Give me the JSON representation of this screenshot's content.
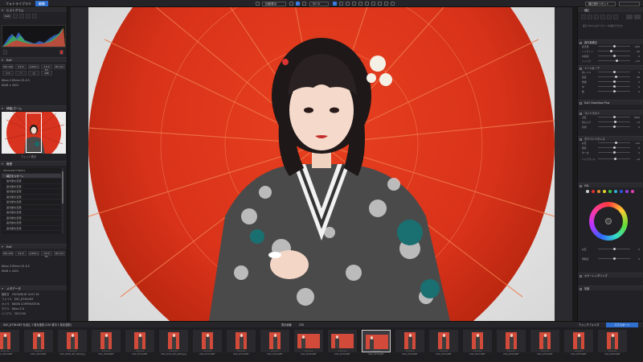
{
  "topbar": {
    "tabs": [
      "フォトライブラリ",
      "編集"
    ],
    "view_label": "比較表示",
    "zoom": "50 %",
    "right_button": "補正値をリセット"
  },
  "left": {
    "histogram_title": "ヒストグラム",
    "exif": {
      "iso": "ISO 100",
      "aperture": "f/1.8",
      "shutter": "1/250 s",
      "ev": "±0.0 EV",
      "focal": "85 mm",
      "lens": "Nikon Z 85mm f/1.8 S",
      "dims": "6048 × 4024"
    },
    "navigator_title": "移動/ズーム",
    "navigator_mode": "フィット表示",
    "history_title": "履歴",
    "history_sub": "Advanced History",
    "history_items": [
      "補正をスタート",
      "露光量を変更",
      "露光量を変更",
      "露光量を変更",
      "露光量を変更",
      "露光量を変更",
      "露光量を変更",
      "露光量を変更",
      "露光量を変更",
      "露光量を変更",
      "露光量を変更",
      "露光量を変更"
    ],
    "meta_title": "メタデータ",
    "meta_rows": [
      [
        "撮影日",
        "2023/06/16 14:07:16"
      ],
      [
        "ファイル",
        "DSC_8736.NEF"
      ],
      [
        "カメラ",
        "NIKON CORPORATION"
      ],
      [
        "モデル",
        "Nikon Z 8"
      ],
      [
        "シリアル",
        "3021740"
      ]
    ]
  },
  "right": {
    "title": "補正",
    "tabs": [
      "ライト",
      "カラー",
      "ディテール"
    ],
    "sections": [
      "露光量補正",
      "トーンカーブ",
      "DxO ClearView Plus",
      "コントラスト",
      "ホワイトバランス",
      "HSL",
      "カラーレンダリング",
      "彩度"
    ],
    "sliders": [
      {
        "label": "露光量",
        "value": "0.00",
        "pos": 0.5
      },
      {
        "label": "ハイライト",
        "value": "-20",
        "pos": 0.4
      },
      {
        "label": "中間調",
        "value": "0",
        "pos": 0.5
      },
      {
        "label": "シャドウ",
        "value": "+15",
        "pos": 0.58
      },
      {
        "label": "黒レベル",
        "value": "0",
        "pos": 0.5
      },
      {
        "label": "強度",
        "value": "50",
        "pos": 0.55
      },
      {
        "label": "微細",
        "value": "0",
        "pos": 0.5
      },
      {
        "label": "中",
        "value": "0",
        "pos": 0.5
      },
      {
        "label": "粗",
        "value": "0",
        "pos": 0.5
      },
      {
        "label": "温度",
        "value": "5250",
        "pos": 0.52
      },
      {
        "label": "色かぶり",
        "value": "+3",
        "pos": 0.53
      },
      {
        "label": "色相",
        "value": "0",
        "pos": 0.5
      },
      {
        "label": "彩度",
        "value": "+10",
        "pos": 0.56
      },
      {
        "label": "輝度",
        "value": "0",
        "pos": 0.5
      },
      {
        "label": "均一性",
        "value": "0",
        "pos": 0.5
      },
      {
        "label": "バイブランス",
        "value": "+8",
        "pos": 0.54
      },
      {
        "label": "彩度",
        "value": "0",
        "pos": 0.5
      },
      {
        "label": "明瞭度",
        "value": "0",
        "pos": 0.5
      }
    ],
    "swatch_colors": [
      "#cccccc",
      "#e03030",
      "#e08a30",
      "#e0d030",
      "#40c040",
      "#30b0d0",
      "#3050e0",
      "#9040e0",
      "#e040b0"
    ]
  },
  "filmstrip": {
    "status": "DSC_8736.NEF を含む 1 枚を選択 (230 枚中 1 枚を選択)",
    "count_label": "表示画像",
    "count": "230",
    "mode_label": "ウォッチフォルダ",
    "btn": "エクスポート",
    "thumbs": [
      "DSC_8702.NEF",
      "DSC_8705.NEF",
      "DSC_8706_DE_16bit.jpg",
      "DSC_8708.NEF",
      "DSC_8710.NEF",
      "DSC_8712_DE_16bit.jpg",
      "DSC_8713.NEF",
      "DSC_8715.NEF",
      "DSC_8720.NEF",
      "DSC_8726.NEF",
      "DSC_8730.NEF",
      "DSC_8736.NEF",
      "DSC_8740.NEF",
      "DSC_8743.NEF",
      "DSC_8747.NEF",
      "DSC_8750.NEF",
      "DSC_8752.NEF",
      "DSC_8755.NEF",
      "DSC_8760.NEF"
    ]
  }
}
